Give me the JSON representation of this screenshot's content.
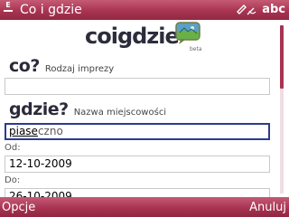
{
  "statusbar": {
    "indicator": "E",
    "title": "Co i gdzie",
    "input_mode": "abc"
  },
  "logo": {
    "text": "coigdzie",
    "sub": "beta"
  },
  "what": {
    "label": "co?",
    "hint": "Rodzaj imprezy",
    "value": ""
  },
  "where": {
    "label": "gdzie?",
    "hint": "Nazwa miejscowości",
    "typed": "piase",
    "suggestion": "czno"
  },
  "from": {
    "label": "Od:",
    "value": "12-10-2009"
  },
  "to": {
    "label": "Do:",
    "value": "26-10-2009"
  },
  "softkeys": {
    "left": "Opcje",
    "right": "Anuluj"
  },
  "colors": {
    "bar": "#a83452",
    "focus_border": "#2c3a8f"
  }
}
